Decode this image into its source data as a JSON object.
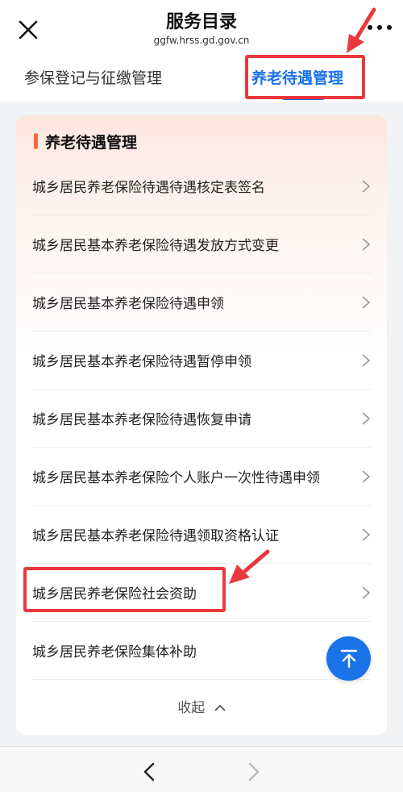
{
  "header": {
    "title": "服务目录",
    "url": "ggfw.hrss.gd.gov.cn"
  },
  "tabs": [
    {
      "label": "参保登记与征缴管理",
      "active": false
    },
    {
      "label": "养老待遇管理",
      "active": true
    }
  ],
  "section": {
    "title": "养老待遇管理",
    "items": [
      {
        "label": "城乡居民养老保险待遇待遇核定表签名"
      },
      {
        "label": "城乡居民基本养老保险待遇发放方式变更"
      },
      {
        "label": "城乡居民基本养老保险待遇申领"
      },
      {
        "label": "城乡居民基本养老保险待遇暂停申领"
      },
      {
        "label": "城乡居民基本养老保险待遇恢复申请"
      },
      {
        "label": "城乡居民基本养老保险个人账户一次性待遇申领"
      },
      {
        "label": "城乡居民基本养老保险待遇领取资格认证"
      },
      {
        "label": "城乡居民养老保险社会资助",
        "highlighted": true
      },
      {
        "label": "城乡居民养老保险集体补助"
      }
    ],
    "collapse_label": "收起"
  },
  "colors": {
    "accent": "#1a73e8",
    "annotation": "#e8383d",
    "section_bar": "#f36c3d"
  },
  "icons": {
    "close": "close-icon",
    "more": "more-dots-icon",
    "chevron": "chevron-right-icon",
    "collapse": "chevron-up-icon",
    "fab": "back-to-top-icon",
    "back": "nav-back-icon",
    "forward": "nav-forward-icon"
  }
}
